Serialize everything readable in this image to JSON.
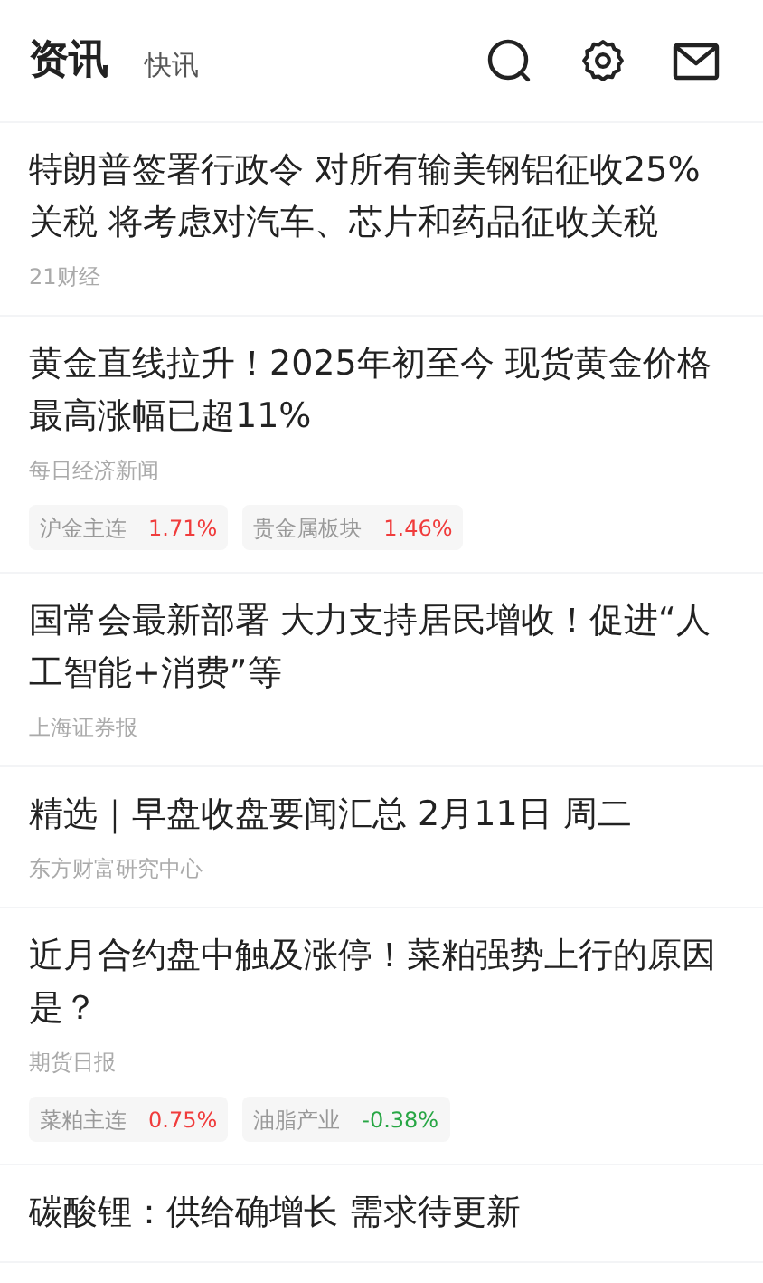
{
  "tabs": [
    {
      "label": "资讯",
      "selected": true
    },
    {
      "label": "快讯",
      "selected": false
    }
  ],
  "articles": [
    {
      "title": "特朗普签署行政令 对所有输美钢铝征收25%关税 将考虑对汽车、芯片和药品征收关税",
      "source": "21财经"
    },
    {
      "title": "黄金直线拉升！2025年初至今 现货黄金价格最高涨幅已超11%",
      "source": "每日经济新闻",
      "tags": [
        {
          "name": "沪金主连",
          "change": "1.71%",
          "color": "#f03c3c"
        },
        {
          "name": "贵金属板块",
          "change": "1.46%",
          "color": "#f03c3c"
        }
      ]
    },
    {
      "title": "国常会最新部署 大力支持居民增收！促进“人工智能+消费”等",
      "source": "上海证券报"
    },
    {
      "title": "精选｜早盘收盘要闻汇总 2月11日 周二",
      "source": "东方财富研究中心"
    },
    {
      "title": "近月合约盘中触及涨停！菜粕强势上行的原因是？",
      "source": "期货日报",
      "tags": [
        {
          "name": "菜粕主连",
          "change": "0.75%",
          "color": "#f03c3c"
        },
        {
          "name": "油脂产业",
          "change": "-0.38%",
          "color": "#27a644"
        }
      ]
    },
    {
      "title": "碳酸锂：供给确增长 需求待更新"
    }
  ]
}
